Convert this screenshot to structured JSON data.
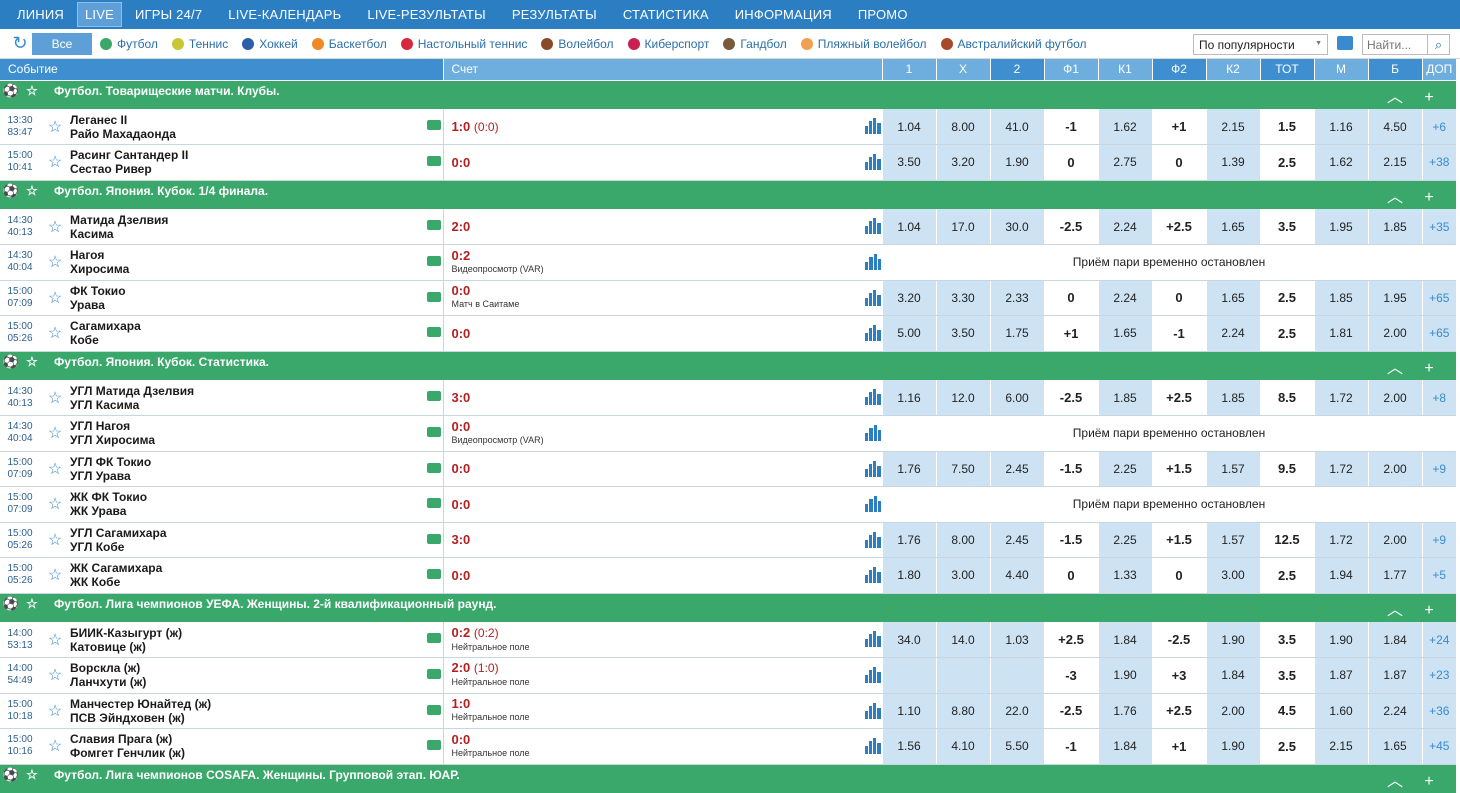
{
  "nav": [
    "ЛИНИЯ",
    "LIVE",
    "ИГРЫ 24/7",
    "LIVE-КАЛЕНДАРЬ",
    "LIVE-РЕЗУЛЬТАТЫ",
    "РЕЗУЛЬТАТЫ",
    "СТАТИСТИКА",
    "ИНФОРМАЦИЯ",
    "ПРОМО"
  ],
  "all_label": "Все",
  "sports": [
    {
      "label": "Футбол",
      "color": "#3aa86b"
    },
    {
      "label": "Теннис",
      "color": "#c8c832"
    },
    {
      "label": "Хоккей",
      "color": "#2b5fa8"
    },
    {
      "label": "Баскетбол",
      "color": "#f08a24"
    },
    {
      "label": "Настольный теннис",
      "color": "#d8283c"
    },
    {
      "label": "Волейбол",
      "color": "#8a4a2a"
    },
    {
      "label": "Киберспорт",
      "color": "#c82050"
    },
    {
      "label": "Гандбол",
      "color": "#7a5a3a"
    },
    {
      "label": "Пляжный волейбол",
      "color": "#f0a050"
    },
    {
      "label": "Австралийский футбол",
      "color": "#a84a2a"
    }
  ],
  "sort_value": "По популярности",
  "search_placeholder": "Найти...",
  "headers": {
    "event": "Событие",
    "score": "Счет",
    "cols": [
      "1",
      "X",
      "2",
      "Ф1",
      "К1",
      "Ф2",
      "К2",
      "ТОТ",
      "М",
      "Б",
      "ДОП"
    ]
  },
  "suspended_text": "Приём пари временно остановлен",
  "groups": [
    {
      "title": "Футбол. Товарищеские матчи. Клубы.",
      "matches": [
        {
          "start": "13:30",
          "elapsed": "83:47",
          "home": "Леганес II",
          "away": "Райо Махадаонда",
          "score": "1:0",
          "half": "(0:0)",
          "note": "",
          "odds": [
            "1.04",
            "8.00",
            "41.0",
            "-1",
            "1.62",
            "+1",
            "2.15",
            "1.5",
            "1.16",
            "4.50",
            "+6"
          ]
        },
        {
          "start": "15:00",
          "elapsed": "10:41",
          "home": "Расинг Сантандер II",
          "away": "Сестао Ривер",
          "score": "0:0",
          "half": "",
          "note": "",
          "odds": [
            "3.50",
            "3.20",
            "1.90",
            "0",
            "2.75",
            "0",
            "1.39",
            "2.5",
            "1.62",
            "2.15",
            "+38"
          ]
        }
      ]
    },
    {
      "title": "Футбол. Япония. Кубок. 1/4 финала.",
      "matches": [
        {
          "start": "14:30",
          "elapsed": "40:13",
          "home": "Матида Дзелвия",
          "away": "Касима",
          "score": "2:0",
          "half": "",
          "note": "",
          "odds": [
            "1.04",
            "17.0",
            "30.0",
            "-2.5",
            "2.24",
            "+2.5",
            "1.65",
            "3.5",
            "1.95",
            "1.85",
            "+35"
          ]
        },
        {
          "start": "14:30",
          "elapsed": "40:04",
          "home": "Нагоя",
          "away": "Хиросима",
          "score": "0:2",
          "half": "",
          "note": "Видеопросмотр (VAR)",
          "suspended": true
        },
        {
          "start": "15:00",
          "elapsed": "07:09",
          "home": "ФК Токио",
          "away": "Урава",
          "score": "0:0",
          "half": "",
          "note": "Матч в Саитаме",
          "odds": [
            "3.20",
            "3.30",
            "2.33",
            "0",
            "2.24",
            "0",
            "1.65",
            "2.5",
            "1.85",
            "1.95",
            "+65"
          ]
        },
        {
          "start": "15:00",
          "elapsed": "05:26",
          "home": "Сагамихара",
          "away": "Кобе",
          "score": "0:0",
          "half": "",
          "note": "",
          "odds": [
            "5.00",
            "3.50",
            "1.75",
            "+1",
            "1.65",
            "-1",
            "2.24",
            "2.5",
            "1.81",
            "2.00",
            "+65"
          ]
        }
      ]
    },
    {
      "title": "Футбол. Япония. Кубок. Статистика.",
      "matches": [
        {
          "start": "14:30",
          "elapsed": "40:13",
          "home": "УГЛ Матида Дзелвия",
          "away": "УГЛ Касима",
          "score": "3:0",
          "half": "",
          "note": "",
          "odds": [
            "1.16",
            "12.0",
            "6.00",
            "-2.5",
            "1.85",
            "+2.5",
            "1.85",
            "8.5",
            "1.72",
            "2.00",
            "+8"
          ]
        },
        {
          "start": "14:30",
          "elapsed": "40:04",
          "home": "УГЛ Нагоя",
          "away": "УГЛ Хиросима",
          "score": "0:0",
          "half": "",
          "note": "Видеопросмотр (VAR)",
          "suspended": true
        },
        {
          "start": "15:00",
          "elapsed": "07:09",
          "home": "УГЛ ФК Токио",
          "away": "УГЛ Урава",
          "score": "0:0",
          "half": "",
          "note": "",
          "odds": [
            "1.76",
            "7.50",
            "2.45",
            "-1.5",
            "2.25",
            "+1.5",
            "1.57",
            "9.5",
            "1.72",
            "2.00",
            "+9"
          ]
        },
        {
          "start": "15:00",
          "elapsed": "07:09",
          "home": "ЖК ФК Токио",
          "away": "ЖК Урава",
          "score": "0:0",
          "half": "",
          "note": "",
          "suspended": true
        },
        {
          "start": "15:00",
          "elapsed": "05:26",
          "home": "УГЛ Сагамихара",
          "away": "УГЛ Кобе",
          "score": "3:0",
          "half": "",
          "note": "",
          "odds": [
            "1.76",
            "8.00",
            "2.45",
            "-1.5",
            "2.25",
            "+1.5",
            "1.57",
            "12.5",
            "1.72",
            "2.00",
            "+9"
          ]
        },
        {
          "start": "15:00",
          "elapsed": "05:26",
          "home": "ЖК Сагамихара",
          "away": "ЖК Кобе",
          "score": "0:0",
          "half": "",
          "note": "",
          "odds": [
            "1.80",
            "3.00",
            "4.40",
            "0",
            "1.33",
            "0",
            "3.00",
            "2.5",
            "1.94",
            "1.77",
            "+5"
          ]
        }
      ]
    },
    {
      "title": "Футбол. Лига чемпионов УЕФА. Женщины. 2-й квалификационный раунд.",
      "matches": [
        {
          "start": "14:00",
          "elapsed": "53:13",
          "home": "БИИК-Казыгурт (ж)",
          "away": "Катовице (ж)",
          "score": "0:2",
          "half": "(0:2)",
          "note": "Нейтральное поле",
          "odds": [
            "34.0",
            "14.0",
            "1.03",
            "+2.5",
            "1.84",
            "-2.5",
            "1.90",
            "3.5",
            "1.90",
            "1.84",
            "+24"
          ]
        },
        {
          "start": "14:00",
          "elapsed": "54:49",
          "home": "Ворскла (ж)",
          "away": "Ланчхути (ж)",
          "score": "2:0",
          "half": "(1:0)",
          "note": "Нейтральное поле",
          "odds": [
            "",
            "",
            "",
            "-3",
            "1.90",
            "+3",
            "1.84",
            "3.5",
            "1.87",
            "1.87",
            "+23"
          ]
        },
        {
          "start": "15:00",
          "elapsed": "10:18",
          "home": "Манчестер Юнайтед (ж)",
          "away": "ПСВ Эйндховен (ж)",
          "score": "1:0",
          "half": "",
          "note": "Нейтральное поле",
          "odds": [
            "1.10",
            "8.80",
            "22.0",
            "-2.5",
            "1.76",
            "+2.5",
            "2.00",
            "4.5",
            "1.60",
            "2.24",
            "+36"
          ]
        },
        {
          "start": "15:00",
          "elapsed": "10:16",
          "home": "Славия Прага (ж)",
          "away": "Фомгет Генчлик (ж)",
          "score": "0:0",
          "half": "",
          "note": "Нейтральное поле",
          "odds": [
            "1.56",
            "4.10",
            "5.50",
            "-1",
            "1.84",
            "+1",
            "1.90",
            "2.5",
            "2.15",
            "1.65",
            "+45"
          ]
        }
      ]
    },
    {
      "title": "Футбол. Лига чемпионов COSAFA. Женщины. Групповой этап. ЮАР.",
      "matches": []
    }
  ]
}
